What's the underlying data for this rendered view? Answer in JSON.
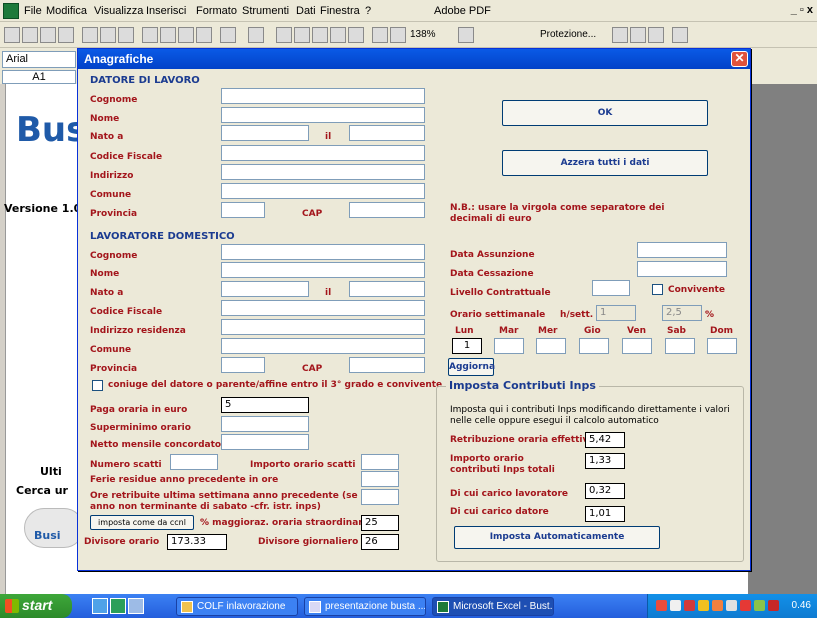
{
  "excel": {
    "menus": [
      "File",
      "Modifica",
      "Visualizza",
      "Inserisci",
      "Formato",
      "Strumenti",
      "Dati",
      "Finestra",
      "?",
      "Adobe PDF"
    ],
    "toolbar_zoom": "138%",
    "toolbar_protezione": "Protezione...",
    "font_name": "Arial",
    "cell_ref": "A1",
    "window_buttons": "_ ▫ x"
  },
  "background": {
    "busta": "Bus",
    "versione": "Versione 1.0",
    "ulti": "Ulti",
    "cerca": "Cerca ur",
    "busi": "Busi"
  },
  "dialog": {
    "title": "Anagrafiche",
    "close": "✕",
    "datore": {
      "heading": "DATORE DI LAVORO",
      "cognome": "Cognome",
      "nome": "Nome",
      "nato_a": "Nato a",
      "il": "il",
      "codice_fiscale": "Codice Fiscale",
      "indirizzo": "Indirizzo",
      "comune": "Comune",
      "provincia": "Provincia",
      "cap": "CAP"
    },
    "lavoratore": {
      "heading": "LAVORATORE DOMESTICO",
      "cognome": "Cognome",
      "nome": "Nome",
      "nato_a": "Nato a",
      "il": "il",
      "codice_fiscale": "Codice Fiscale",
      "indirizzo": "Indirizzo residenza",
      "comune": "Comune",
      "provincia": "Provincia",
      "cap": "CAP",
      "coniuge": "coniuge del datore o parente/affine entro il 3° grado e convivente"
    },
    "paga": {
      "paga_oraria": "Paga oraria in euro",
      "paga_oraria_value": "5",
      "superminimo": "Superminimo orario",
      "netto_mensile": "Netto mensile concordato",
      "numero_scatti": "Numero scatti",
      "importo_scatti": "Importo orario scatti",
      "ferie": "Ferie residue anno precedente in ore",
      "ore_retribuite": "Ore retribuite ultima settimana anno precedente (se anno non terminante di sabato -cfr. istr. inps)",
      "imposta_ccnl": "imposta come da ccnl",
      "maggioraz": "% maggioraz. oraria straordinari",
      "maggioraz_value": "25",
      "divisore_orario": "Divisore orario",
      "divisore_orario_value": "173.33",
      "divisore_giornaliero": "Divisore giornaliero",
      "divisore_giornaliero_value": "26"
    },
    "buttons": {
      "ok": "OK",
      "azzera": "Azzera tutti i dati",
      "aggiorna": "Aggiorna",
      "imposta_auto": "Imposta Automaticamente"
    },
    "nb": "N.B.: usare la virgola come separatore dei decimali di euro",
    "contratto": {
      "data_assunzione": "Data Assunzione",
      "data_cessazione": "Data Cessazione",
      "livello": "Livello Contrattuale",
      "convivente": "Convivente",
      "orario_settimanale": "Orario settimanale",
      "h_sett": "h/sett.",
      "h_sett_value": "1",
      "percent_value": "2,5",
      "percent": "%",
      "days": [
        "Lun",
        "Mar",
        "Mer",
        "Gio",
        "Ven",
        "Sab",
        "Dom"
      ],
      "day_values": [
        "1",
        "",
        "",
        "",
        "",
        "",
        ""
      ]
    },
    "inps": {
      "title": "Imposta Contributi Inps",
      "description": "Imposta qui i contributi Inps modificando direttamente i valori nelle celle oppure esegui il calcolo automatico",
      "retribuzione": "Retribuzione oraria effettiva",
      "retribuzione_value": "5,42",
      "importo_totali": "Importo orario contributi Inps totali",
      "importo_totali_value": "1,33",
      "carico_lavoratore": "Di cui carico lavoratore",
      "carico_lavoratore_value": "0,32",
      "carico_datore": "Di cui carico datore",
      "carico_datore_value": "1,01"
    }
  },
  "taskbar": {
    "start": "start",
    "tasks": [
      "COLF inlavorazione",
      "presentazione busta ...",
      "Microsoft Excel - Bust..."
    ],
    "clock": "0.46"
  }
}
